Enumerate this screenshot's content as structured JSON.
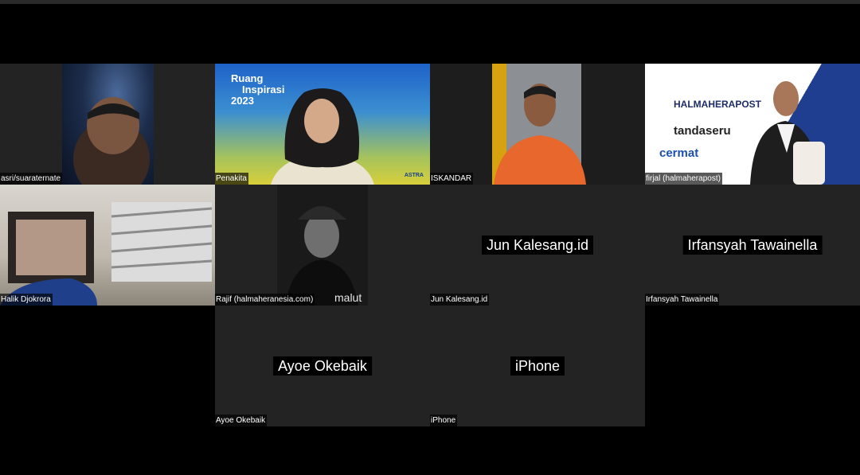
{
  "participants": [
    {
      "name": "asri/suarate­rnate",
      "center_label": "",
      "video": true
    },
    {
      "name": "Penakita",
      "center_label": "",
      "video": true
    },
    {
      "name": "ISKANDAR",
      "center_label": "",
      "video": true
    },
    {
      "name": "firjal (halmaherapost)",
      "center_label": "",
      "video": true
    },
    {
      "name": "Halik Djokrora",
      "center_label": "",
      "video": true
    },
    {
      "name": "Rajif (halmaheranesia.com)",
      "center_label": "",
      "video": true
    },
    {
      "name": "Jun Kalesang.id",
      "center_label": "Jun Kalesang.id",
      "video": false
    },
    {
      "name": "Irfansyah Tawainella",
      "center_label": "Irfansyah Tawainella",
      "video": false
    },
    {
      "name": "Ayoe Okebaik",
      "center_label": "Ayoe Okebaik",
      "video": false
    },
    {
      "name": "iPhone",
      "center_label": "iPhone",
      "video": false
    }
  ],
  "banners": {
    "inspirasi_line1": "Ruang",
    "inspirasi_line2": "Inspirasi",
    "inspirasi_year": "2023",
    "astra": "ASTRA",
    "halmaherapost": "HALMAHERAPOST",
    "tandaseru": "tandaseru",
    "cermat": "cermat",
    "malut": "malut"
  },
  "colors": {
    "tile_bg": "#232323",
    "page_bg": "#000000"
  }
}
